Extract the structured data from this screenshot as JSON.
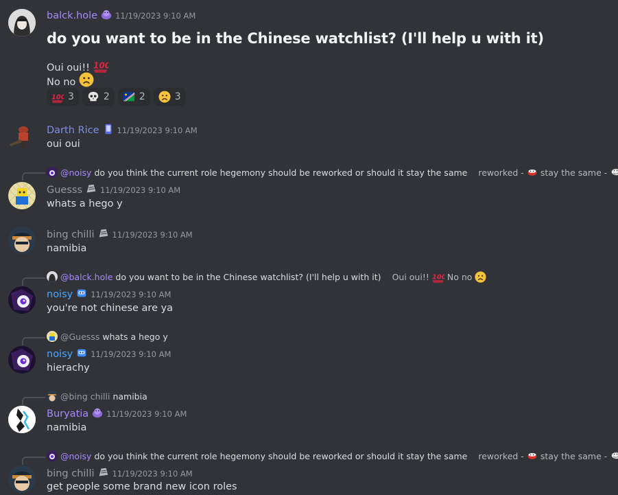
{
  "messages": {
    "m1": {
      "author": "balck.hole",
      "timestamp": "11/19/2023 9:10 AM",
      "title": "do you want to be in the Chinese watchlist? (I'll help u with it)",
      "line1": "Oui oui!!",
      "line2": "No no",
      "reactions": [
        {
          "emoji": "hundred-points-emoji",
          "count": "3"
        },
        {
          "emoji": "skull-emoji",
          "count": "2"
        },
        {
          "emoji": "namibia-flag-emoji",
          "count": "2"
        },
        {
          "emoji": "confused-face-emoji",
          "count": "3"
        }
      ]
    },
    "m2": {
      "author": "Darth Rice",
      "timestamp": "11/19/2023 9:10 AM",
      "text": "oui oui"
    },
    "m3": {
      "reply_author": "@noisy",
      "reply_text": "do you think the current role hegemony should be reworked or should it stay the same",
      "reply_extra_1": "reworked -",
      "reply_extra_2": "stay the same -",
      "author": "Guesss",
      "timestamp": "11/19/2023 9:10 AM",
      "text": "whats a hego y"
    },
    "m4": {
      "author": "bing chilli",
      "timestamp": "11/19/2023 9:10 AM",
      "text": "namibia"
    },
    "m5": {
      "reply_author": "@balck.hole",
      "reply_text": "do you want to be in the Chinese watchlist? (I'll help u with it)",
      "reply_extra_1": "Oui oui!!",
      "reply_extra_2": "No no",
      "author": "noisy",
      "timestamp": "11/19/2023 9:10 AM",
      "text": "you're not chinese are ya"
    },
    "m6": {
      "reply_author": "@Guesss",
      "reply_text": "whats a hego y",
      "author": "noisy",
      "timestamp": "11/19/2023 9:10 AM",
      "text": "hierachy"
    },
    "m7": {
      "reply_author": "@bing chilli",
      "reply_text": "namibia",
      "author": "Buryatia",
      "timestamp": "11/19/2023 9:10 AM",
      "text": "namibia"
    },
    "m8": {
      "reply_author": "@noisy",
      "reply_text": "do you think the current role hegemony should be reworked or should it stay the same",
      "reply_extra_1": "reworked -",
      "reply_extra_2": "stay the same -",
      "author": "bing chilli",
      "timestamp": "11/19/2023 9:10 AM",
      "text": "get people some brand new icon roles"
    }
  },
  "colors": {
    "background": "#313338",
    "purple_name": "#a78bfa",
    "blue_name": "#4aa9ff",
    "muted": "#949ba4"
  }
}
